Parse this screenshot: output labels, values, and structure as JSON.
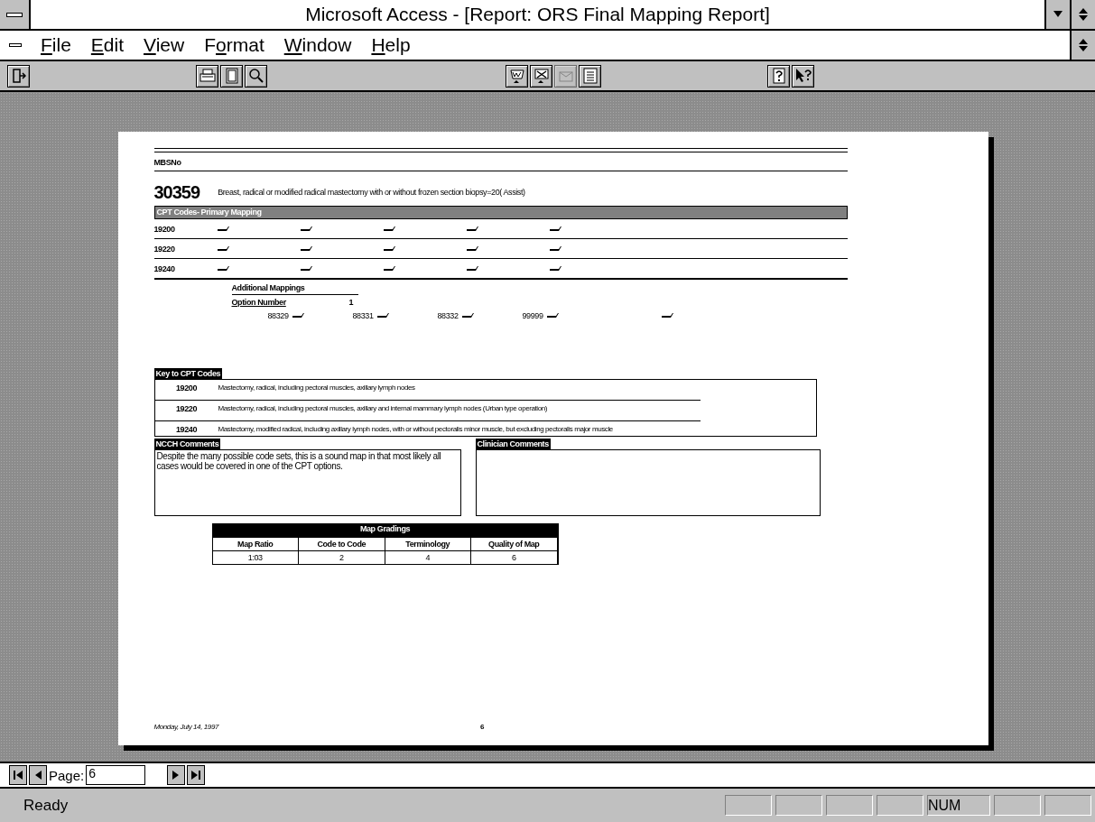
{
  "window": {
    "title": "Microsoft Access - [Report: ORS Final Mapping Report]"
  },
  "menu": [
    {
      "key": "F",
      "rest": "ile"
    },
    {
      "key": "E",
      "rest": "dit"
    },
    {
      "key": "V",
      "rest": "iew"
    },
    {
      "before": "F",
      "key": "o",
      "rest": "rmat"
    },
    {
      "key": "W",
      "rest": "indow"
    },
    {
      "key": "H",
      "rest": "elp"
    }
  ],
  "toolbar": [
    {
      "kind": "close",
      "disabled": false
    },
    {
      "kind": "gap"
    },
    {
      "kind": "print",
      "disabled": false
    },
    {
      "kind": "page",
      "disabled": false
    },
    {
      "kind": "zoom",
      "disabled": false
    },
    {
      "kind": "gap"
    },
    {
      "kind": "word",
      "disabled": false
    },
    {
      "kind": "excel",
      "disabled": false
    },
    {
      "kind": "mail",
      "disabled": true
    },
    {
      "kind": "database",
      "disabled": false
    },
    {
      "kind": "gap"
    },
    {
      "kind": "cuecards",
      "disabled": false
    },
    {
      "kind": "helppointer",
      "disabled": false
    }
  ],
  "report": {
    "mbs_label": "MBSNo",
    "mbs_number": "30359",
    "description": "Breast, radical or modified radical mastectomy with or without frozen section biopsy=20( Assist)",
    "primary_heading": "CPT Codes- Primary Mapping",
    "primary_rows": [
      {
        "code": "19200",
        "checks": [
          true,
          true,
          true,
          true,
          true
        ]
      },
      {
        "code": "19220",
        "checks": [
          true,
          true,
          true,
          true,
          true
        ]
      },
      {
        "code": "19240",
        "checks": [
          true,
          true,
          true,
          true,
          true
        ]
      }
    ],
    "additional_heading": "Additional Mappings",
    "option_label": "Option Number",
    "option_value": "1",
    "additional": [
      {
        "code": "88329",
        "checked": true
      },
      {
        "code": "88331",
        "checked": true
      },
      {
        "code": "88332",
        "checked": true
      },
      {
        "code": "99999",
        "checked": true
      },
      {
        "checked": true
      }
    ],
    "key_heading": "Key to CPT Codes",
    "key_rows": [
      {
        "code": "19200",
        "text": "Mastectomy, radical, including pectoral muscles, axillary lymph nodes"
      },
      {
        "code": "19220",
        "text": "Mastectomy, radical, including pectoral muscles, axillary and internal mammary lymph nodes (Urban type operation)"
      },
      {
        "code": "19240",
        "text": "Mastectomy, modified radical, including axillary lymph nodes, with or without pectoralis minor muscle, but excluding pectoralis major muscle"
      }
    ],
    "ncch_heading": "NCCH Comments",
    "ncch_text": "Despite the many possible code sets, this is a sound map in that most likely all cases would be covered in one of the CPT options.",
    "clinician_heading": "Clinician Comments",
    "grading": {
      "title": "Map Gradings",
      "columns": [
        "Map Ratio",
        "Code to Code",
        "Terminology",
        "Quality of Map"
      ],
      "values": [
        "1:03",
        "2",
        "4",
        "6"
      ]
    },
    "footer_date": "Monday, July 14, 1997",
    "footer_page": "6"
  },
  "navigator": {
    "label": "Page:",
    "value": "6"
  },
  "status_bar": {
    "text": "Ready",
    "indicators": [
      "NUM"
    ]
  }
}
